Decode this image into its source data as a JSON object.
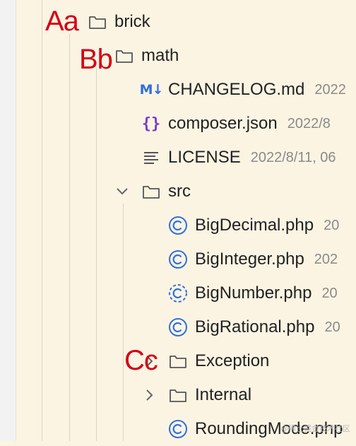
{
  "tree": {
    "items": [
      {
        "name": "brick",
        "meta": ""
      },
      {
        "name": "math",
        "meta": ""
      },
      {
        "name": "CHANGELOG.md",
        "meta": "2022"
      },
      {
        "name": "composer.json",
        "meta": "2022/8"
      },
      {
        "name": "LICENSE",
        "meta": "2022/8/11, 06"
      },
      {
        "name": "src",
        "meta": ""
      },
      {
        "name": "BigDecimal.php",
        "meta": "20"
      },
      {
        "name": "BigInteger.php",
        "meta": "202"
      },
      {
        "name": "BigNumber.php",
        "meta": "20"
      },
      {
        "name": "BigRational.php",
        "meta": "20"
      },
      {
        "name": "Exception",
        "meta": ""
      },
      {
        "name": "Internal",
        "meta": ""
      },
      {
        "name": "RoundingMode.php",
        "meta": ""
      }
    ]
  },
  "annotations": {
    "a": "Aa",
    "b": "Bb",
    "c": "Cc"
  },
  "icons": {
    "md": "M↓",
    "json": "{}",
    "folder": "folder-icon",
    "class": "php-class-icon",
    "abstract": "php-abstract-class-icon",
    "license": "text-lines-icon"
  },
  "colors": {
    "annotation": "#d40014",
    "accent": "#2f6fdb",
    "json": "#7d3cc9"
  },
  "watermark": "@稀土掘金技术社区"
}
